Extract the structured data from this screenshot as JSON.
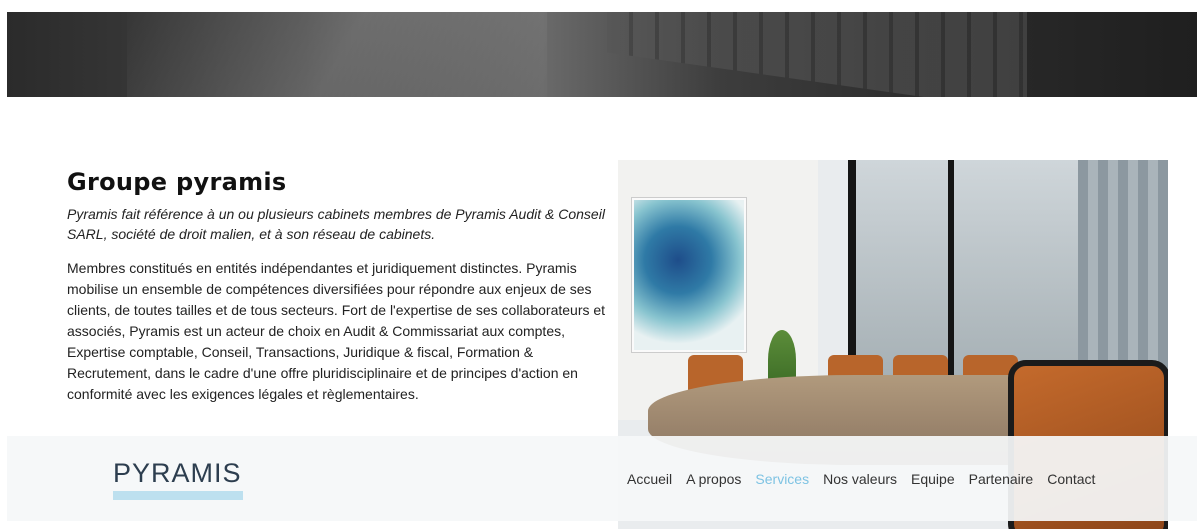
{
  "section": {
    "title": "Groupe pyramis",
    "lead": "Pyramis fait référence à un ou plusieurs cabinets membres de Pyramis Audit & Conseil SARL, société de droit malien, et à son réseau de cabinets.",
    "body": "Membres constitués en entités indépendantes et juridiquement distinctes. Pyramis mobilise un ensemble de compétences diversifiées pour répondre aux enjeux de ses clients, de toutes tailles et de tous secteurs. Fort de l'expertise de ses collaborateurs et associés, Pyramis est un acteur de choix en Audit & Commissariat aux comptes, Expertise comptable, Conseil, Transactions, Juridique & fiscal, Formation & Recrutement, dans le cadre d'une offre pluridisciplinaire et de principes d'action en conformité avec les exigences légales et règlementaires."
  },
  "navbar": {
    "logo": "PYRAMIS",
    "items": [
      {
        "label": "Accueil"
      },
      {
        "label": "A propos"
      },
      {
        "label": "Services"
      },
      {
        "label": "Nos valeurs"
      },
      {
        "label": "Equipe"
      },
      {
        "label": "Partenaire"
      },
      {
        "label": "Contact"
      }
    ],
    "active_item": "Services"
  },
  "colors": {
    "accent": "#7ec3e3",
    "logo_bar": "#bde0ef",
    "logo_text": "#2d3e4f"
  }
}
